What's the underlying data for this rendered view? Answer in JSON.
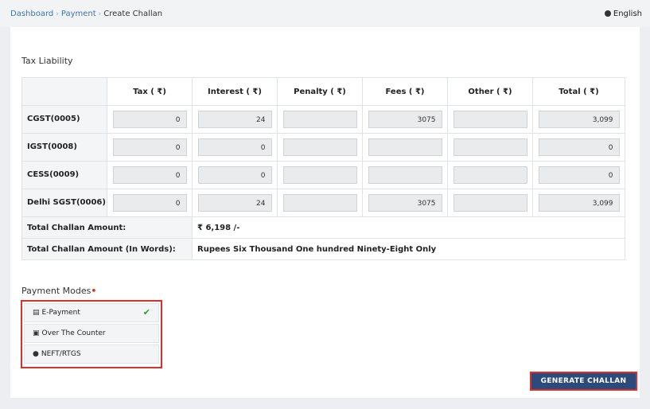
{
  "breadcrumb": {
    "items": [
      "Dashboard",
      "Payment"
    ],
    "current": "Create Challan"
  },
  "language": {
    "label": "English"
  },
  "tax_liability": {
    "title": "Tax Liability",
    "columns": [
      "",
      "Tax ( ₹)",
      "Interest ( ₹)",
      "Penalty ( ₹)",
      "Fees ( ₹)",
      "Other ( ₹)",
      "Total ( ₹)"
    ],
    "rows": [
      {
        "name": "CGST(0005)",
        "values": [
          "0",
          "24",
          "",
          "3075",
          "",
          "3,099"
        ]
      },
      {
        "name": "IGST(0008)",
        "values": [
          "0",
          "0",
          "",
          "",
          "",
          "0"
        ]
      },
      {
        "name": "CESS(0009)",
        "values": [
          "0",
          "0",
          "",
          "",
          "",
          "0"
        ]
      },
      {
        "name": "Delhi SGST(0006)",
        "values": [
          "0",
          "24",
          "",
          "3075",
          "",
          "3,099"
        ]
      }
    ],
    "total_amount_label": "Total Challan Amount:",
    "total_amount_value": "₹ 6,198 /-",
    "total_words_label": "Total Challan Amount (In Words):",
    "total_words_value": "Rupees Six Thousand One hundred Ninety-Eight Only"
  },
  "payment_modes": {
    "label": "Payment Modes",
    "required_mark": "•",
    "options": [
      {
        "label": "E-Payment",
        "icon": "card-icon",
        "selected": true,
        "check": "✔"
      },
      {
        "label": "Over The Counter",
        "icon": "cash-icon",
        "selected": false
      },
      {
        "label": "NEFT/RTGS",
        "icon": "globe-icon",
        "selected": false
      }
    ]
  },
  "actions": {
    "generate_label": "GENERATE CHALLAN"
  },
  "colors": {
    "accent_red": "#d9302c",
    "button_blue": "#2c4a7a",
    "link_blue": "#3a76b8"
  }
}
